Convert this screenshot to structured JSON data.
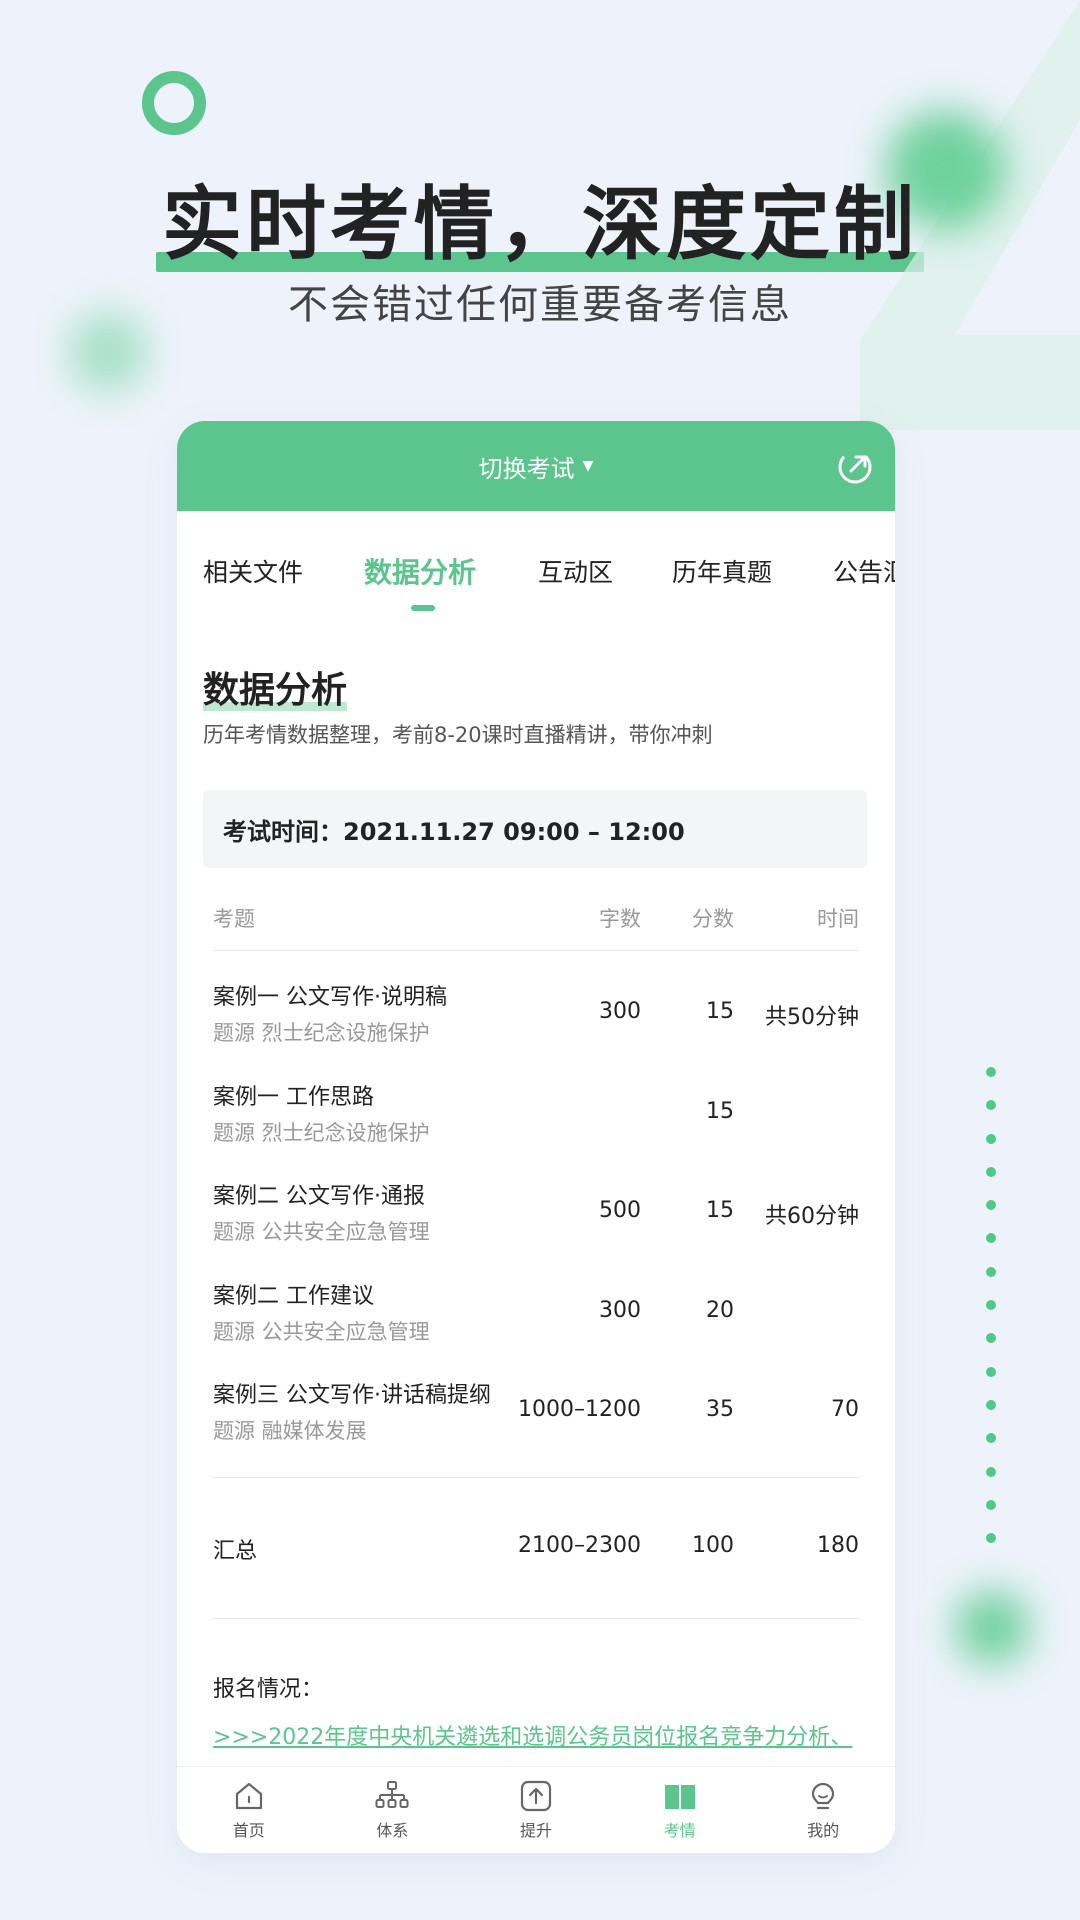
{
  "headline": "实时考情，深度定制",
  "subheadline": "不会错过任何重要备考信息",
  "header": {
    "exam_switch_label": "切换考试"
  },
  "tabs": [
    {
      "label": "相关文件"
    },
    {
      "label": "数据分析"
    },
    {
      "label": "互动区"
    },
    {
      "label": "历年真题"
    },
    {
      "label": "公告汇"
    }
  ],
  "active_tab": "数据分析",
  "section": {
    "title": "数据分析",
    "description": "历年考情数据整理，考前8-20课时直播精讲，带你冲刺"
  },
  "exam_time": "考试时间：2021.11.27 09:00 – 12:00",
  "table": {
    "headers": {
      "question": "考题",
      "words": "字数",
      "score": "分数",
      "time": "时间"
    },
    "rows": [
      {
        "title": "案例一 公文写作·说明稿",
        "source": "题源 烈士纪念设施保护",
        "words": "300",
        "score": "15",
        "time": "共50分钟"
      },
      {
        "title": "案例一 工作思路",
        "source": "题源 烈士纪念设施保护",
        "words": "",
        "score": "15",
        "time": ""
      },
      {
        "title": "案例二 公文写作·通报",
        "source": "题源 公共安全应急管理",
        "words": "500",
        "score": "15",
        "time": "共60分钟"
      },
      {
        "title": "案例二 工作建议",
        "source": "题源 公共安全应急管理",
        "words": "300",
        "score": "20",
        "time": ""
      },
      {
        "title": "案例三 公文写作·讲话稿提纲",
        "source": "题源 融媒体发展",
        "words": "1000–1200",
        "score": "35",
        "time": "70"
      }
    ],
    "total": {
      "label": "汇总",
      "words": "2100–2300",
      "score": "100",
      "time": "180"
    }
  },
  "registration": {
    "label": "报名情况：",
    "link": ">>>2022年度中央机关遴选和选调公务员岗位报名竞争力分析、"
  },
  "bottom_nav": [
    {
      "label": "首页",
      "icon": "home-icon"
    },
    {
      "label": "体系",
      "icon": "hierarchy-icon"
    },
    {
      "label": "提升",
      "icon": "upload-icon"
    },
    {
      "label": "考情",
      "icon": "book-icon"
    },
    {
      "label": "我的",
      "icon": "profile-icon"
    }
  ],
  "active_nav": "考情",
  "colors": {
    "accent": "#5cc58e",
    "background": "#eef3fb",
    "link": "#5cc58e"
  }
}
